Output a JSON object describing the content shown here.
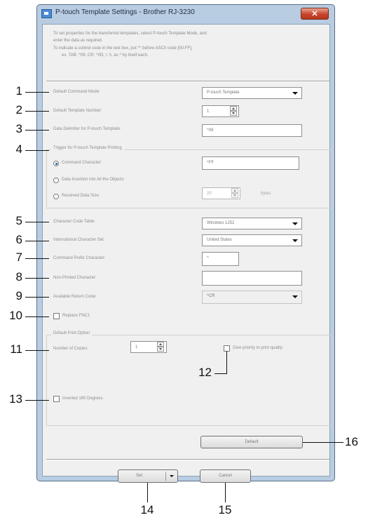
{
  "window": {
    "title": "P-touch Template Settings - Brother RJ-3230",
    "close_glyph": "✕"
  },
  "description": {
    "line1": "To set properties for the transferred templates, select P-touch Template Mode, and",
    "line2": "enter the data as required.",
    "line3": "To indicate a control code in the text box, put '^' before ASCII code [00-FF],",
    "line4": "ex. TAB: ^09,  CR: ^0D,  \\: \\\\,  as ^ by itself each."
  },
  "fields": {
    "command_mode": {
      "label": "Default Command Mode:",
      "value": "P-touch Template"
    },
    "template_number": {
      "label": "Default Template Number:",
      "value": "1"
    },
    "data_delimiter": {
      "label": "Data Delimiter for P-touch Template:",
      "value": "^09"
    },
    "trigger_group": {
      "label": "Trigger for P-touch Template Printing",
      "command_character": {
        "label": "Command Character:",
        "value": "^FF"
      },
      "data_insertion": {
        "label": "Data Insertion into All the Objects"
      },
      "received_data_size": {
        "label": "Received Data Size:",
        "value": "20",
        "unit": "bytes"
      }
    },
    "character_code_table": {
      "label": "Character Code Table:",
      "value": "Windows 1252"
    },
    "international_charset": {
      "label": "International Character Set:",
      "value": "United States"
    },
    "command_prefix": {
      "label": "Command Prefix Character:",
      "value": "^"
    },
    "non_printed": {
      "label": "Non-Printed Character:",
      "value": ""
    },
    "return_code": {
      "label": "Available Return Code:",
      "value": "^CR"
    },
    "replace_fnc1": {
      "label": "Replace FNC1"
    },
    "print_option": {
      "label": "Default Print Option",
      "copies_label": "Number of Copies:",
      "copies_value": "1",
      "priority_label": "Give priority to print quality"
    },
    "inverted": {
      "label": "Inverted 180 Degrees"
    }
  },
  "buttons": {
    "default": "Default",
    "set": "Set",
    "cancel": "Cancel"
  },
  "callouts": {
    "n1": "1",
    "n2": "2",
    "n3": "3",
    "n4": "4",
    "n5": "5",
    "n6": "6",
    "n7": "7",
    "n8": "8",
    "n9": "9",
    "n10": "10",
    "n11": "11",
    "n12": "12",
    "n13": "13",
    "n14": "14",
    "n15": "15",
    "n16": "16"
  },
  "colors": {
    "frame": "#b9cde2",
    "close": "#c8452c",
    "client": "#f0f0f0",
    "radio_selected": "#1c5aa6"
  }
}
